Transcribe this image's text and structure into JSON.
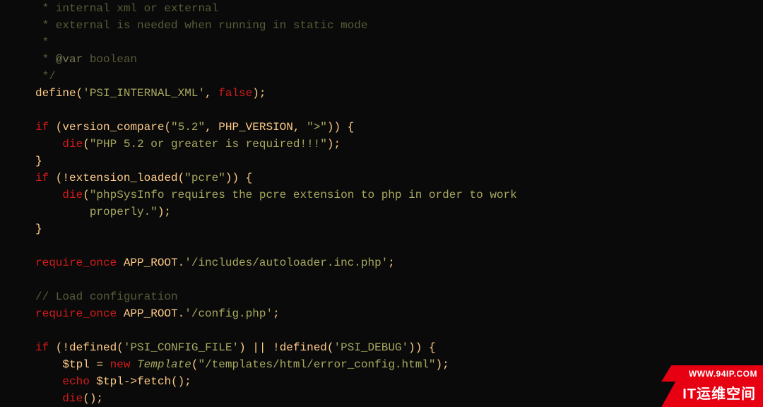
{
  "code": {
    "l1": " * internal xml or external",
    "l2": " * external is needed when running in static mode",
    "l3": " *",
    "l4a": " * ",
    "l4b": "@var",
    "l4c": " boolean",
    "l5": " */",
    "l6a": "define",
    "l6b": "(",
    "l6c": "'PSI_INTERNAL_XML'",
    "l6d": ", ",
    "l6e": "false",
    "l6f": ");",
    "l8a": "if",
    "l8b": " (",
    "l8c": "version_compare",
    "l8d": "(",
    "l8e": "\"5.2\"",
    "l8f": ", PHP_VERSION, ",
    "l8g": "\">\"",
    "l8h": ")) {",
    "l9a": "    ",
    "l9b": "die",
    "l9c": "(",
    "l9d": "\"PHP 5.2 or greater is required!!!\"",
    "l9e": ");",
    "l10": "}",
    "l11a": "if",
    "l11b": " (!",
    "l11c": "extension_loaded",
    "l11d": "(",
    "l11e": "\"pcre\"",
    "l11f": ")) {",
    "l12a": "    ",
    "l12b": "die",
    "l12c": "(",
    "l12d": "\"phpSysInfo requires the pcre extension to php in order to work",
    "l13a": "        properly.\"",
    "l13b": ");",
    "l14": "}",
    "l16a": "require_once",
    "l16b": " APP_ROOT.",
    "l16c": "'/includes/autoloader.inc.php'",
    "l16d": ";",
    "l18": "// Load configuration",
    "l19a": "require_once",
    "l19b": " APP_ROOT.",
    "l19c": "'/config.php'",
    "l19d": ";",
    "l21a": "if",
    "l21b": " (!",
    "l21c": "defined",
    "l21d": "(",
    "l21e": "'PSI_CONFIG_FILE'",
    "l21f": ") || !",
    "l21g": "defined",
    "l21h": "(",
    "l21i": "'PSI_DEBUG'",
    "l21j": ")) {",
    "l22a": "    $tpl = ",
    "l22b": "new",
    "l22c": " ",
    "l22d": "Template",
    "l22e": "(",
    "l22f": "\"/templates/html/error_config.html\"",
    "l22g": ");",
    "l23a": "    ",
    "l23b": "echo",
    "l23c": " $tpl->",
    "l23d": "fetch",
    "l23e": "();",
    "l24a": "    ",
    "l24b": "die",
    "l24c": "();"
  },
  "watermark": {
    "url": "WWW.94IP.COM",
    "brand": "IT运维空间"
  }
}
